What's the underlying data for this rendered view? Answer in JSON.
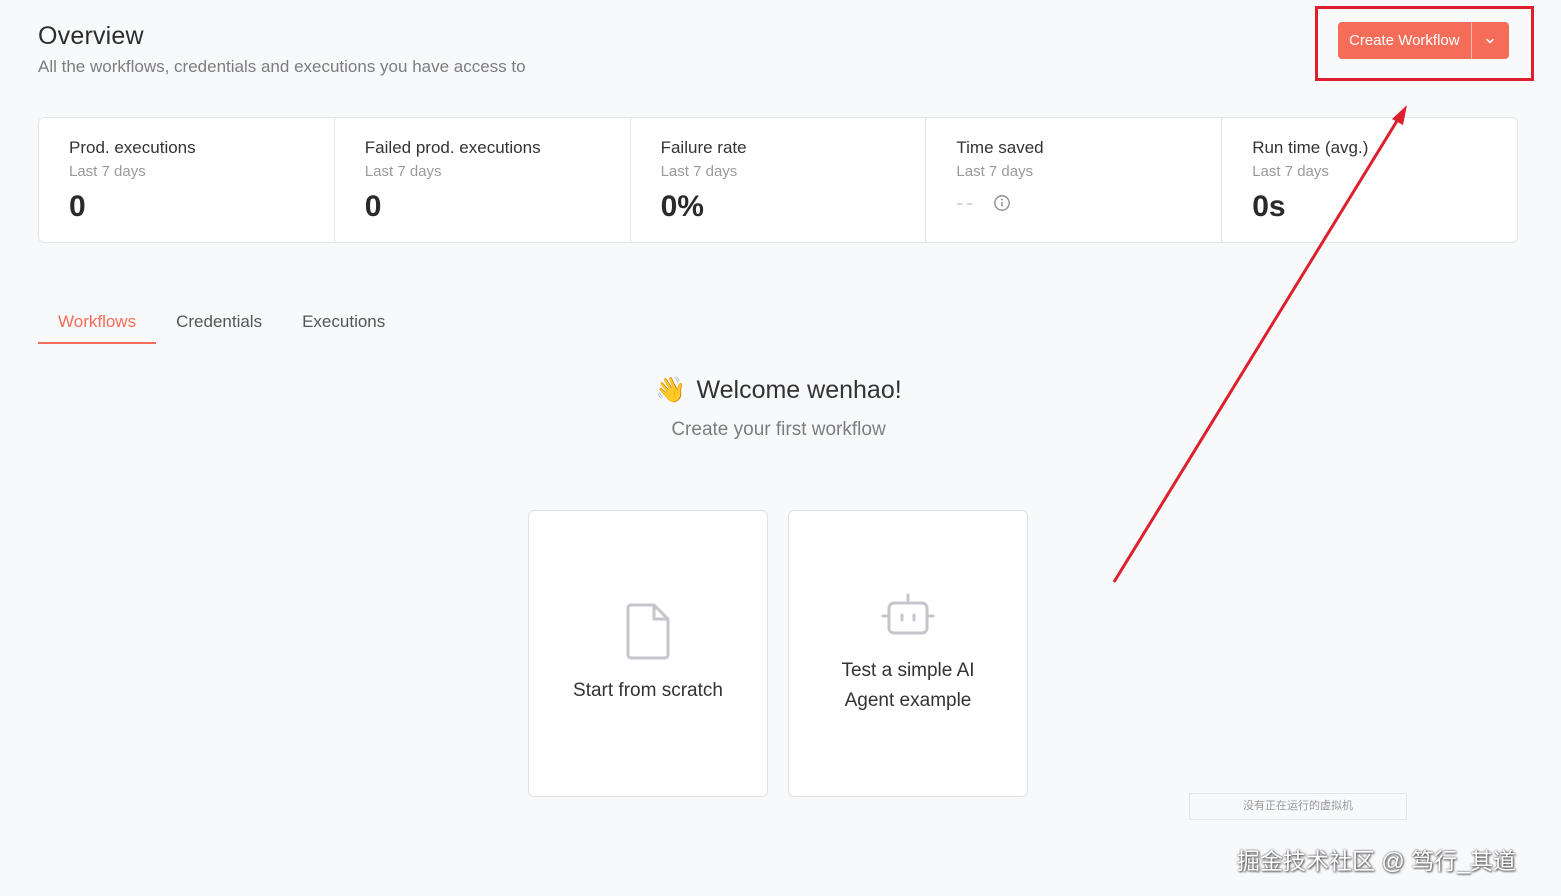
{
  "header": {
    "title": "Overview",
    "subtitle": "All the workflows, credentials and executions you have access to"
  },
  "actions": {
    "create_label": "Create Workflow",
    "caret_icon": "chevron-down-icon",
    "accent": "#f56c58"
  },
  "stats": [
    {
      "label": "Prod. executions",
      "sub": "Last 7 days",
      "value": "0"
    },
    {
      "label": "Failed prod. executions",
      "sub": "Last 7 days",
      "value": "0"
    },
    {
      "label": "Failure rate",
      "sub": "Last 7 days",
      "value": "0%"
    },
    {
      "label": "Time saved",
      "sub": "Last 7 days",
      "value": "--",
      "icon": "info-icon"
    },
    {
      "label": "Run time (avg.)",
      "sub": "Last 7 days",
      "value": "0s"
    }
  ],
  "tabs": [
    {
      "label": "Workflows",
      "active": true
    },
    {
      "label": "Credentials",
      "active": false
    },
    {
      "label": "Executions",
      "active": false
    }
  ],
  "welcome": {
    "emoji": "👋",
    "title": "Welcome wenhao!",
    "subtitle": "Create your first workflow"
  },
  "cards": [
    {
      "label": "Start from scratch",
      "icon": "file-icon"
    },
    {
      "label_line1": "Test a simple AI",
      "label_line2": "Agent example",
      "icon": "robot-icon"
    }
  ],
  "vm_status": "没有正在运行的虚拟机",
  "watermark": "掘金技术社区 @ 笃行_其道",
  "annotation_color": "#dd1f2e"
}
